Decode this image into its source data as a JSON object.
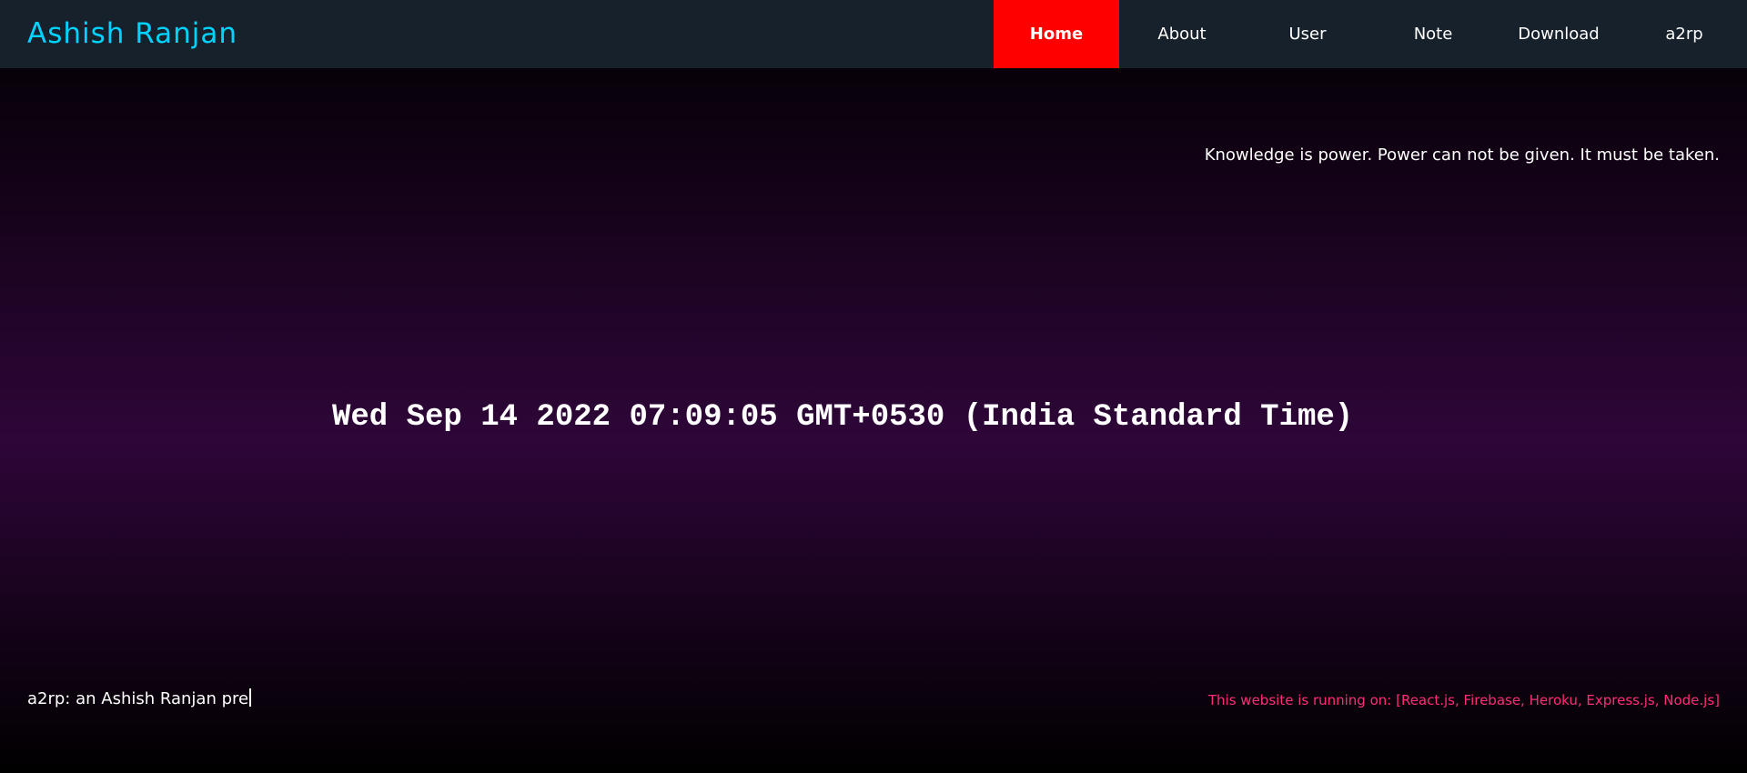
{
  "navbar": {
    "brand": "Ashish Ranjan",
    "items": [
      {
        "label": "Home"
      },
      {
        "label": "About"
      },
      {
        "label": "User"
      },
      {
        "label": "Note"
      },
      {
        "label": "Download"
      },
      {
        "label": "a2rp"
      }
    ],
    "active_item": "Home"
  },
  "main": {
    "quote": "Knowledge is power. Power can not be given. It must be taken.",
    "clock": "Wed Sep 14 2022 07:09:05 GMT+0530 (India Standard Time)"
  },
  "footer": {
    "typed_text": "a2rp: an Ashish Ranjan pre",
    "tech_text": "This website is running on: [React.js, Firebase, Heroku, Express.js, Node.js]"
  },
  "colors": {
    "navbar_bg": "#17212b",
    "brand": "#00d3ff",
    "active_nav": "#ff0000",
    "tech_text": "#ff2d77"
  }
}
